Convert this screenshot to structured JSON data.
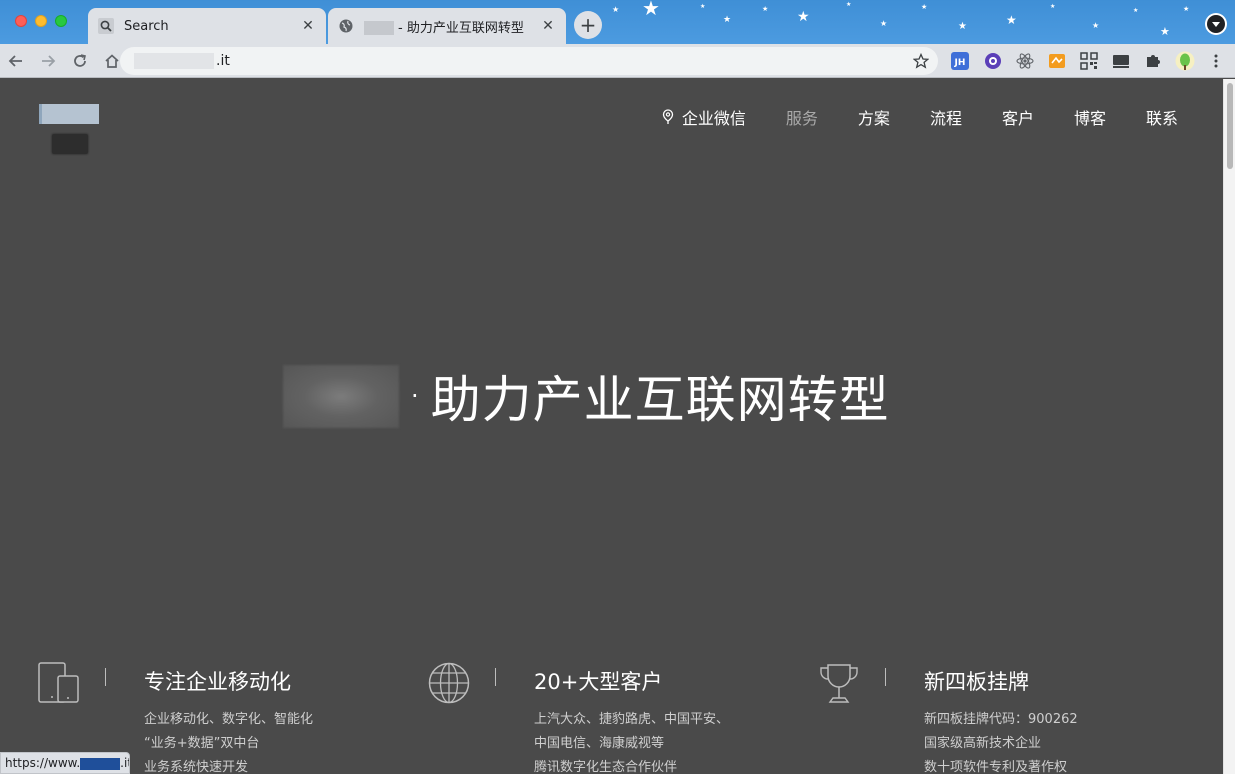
{
  "browser": {
    "tabs": [
      {
        "label": "Search",
        "icon": "search-icon",
        "active": true
      },
      {
        "label": "- 助力产业互联网转型",
        "icon": "globe-icon",
        "active": false
      }
    ],
    "new_tab_label": "+",
    "address": ".it",
    "status_url_prefix": "https://www.",
    "status_url_suffix": ".it",
    "extensions": [
      "jh-extension-icon",
      "w-extension-icon",
      "react-devtools-icon",
      "orange-extension-icon",
      "qr-code-icon",
      "cast-icon",
      "puzzle-extensions-icon",
      "profile-avatar-icon",
      "kebab-menu-icon"
    ]
  },
  "site": {
    "nav": [
      {
        "label": "企业微信",
        "icon": "location-pin-icon",
        "muted": false
      },
      {
        "label": "服务",
        "muted": true
      },
      {
        "label": "方案",
        "muted": false
      },
      {
        "label": "流程",
        "muted": false
      },
      {
        "label": "客户",
        "muted": false
      },
      {
        "label": "博客",
        "muted": false
      },
      {
        "label": "联系",
        "muted": false
      }
    ],
    "hero": {
      "separator": "·",
      "title": "助力产业互联网转型"
    },
    "features": [
      {
        "icon": "mobile-devices-icon",
        "heading": "专注企业移动化",
        "lines": [
          "企业移动化、数字化、智能化",
          "“业务+数据”双中台",
          "业务系统快速开发"
        ]
      },
      {
        "icon": "globe-icon",
        "heading": "20+大型客户",
        "lines": [
          "上汽大众、捷豹路虎、中国平安、",
          "中国电信、海康威视等",
          "腾讯数字化生态合作伙伴"
        ]
      },
      {
        "icon": "trophy-icon",
        "heading": "新四板挂牌",
        "lines": [
          "新四板挂牌代码：900262",
          "国家级高新技术企业",
          "数十项软件专利及著作权"
        ]
      }
    ]
  },
  "colors": {
    "page_bg": "#4a4a4a",
    "tabbar_bg": "#4c9be0",
    "chrome_bg": "#dee1e6",
    "nav_muted": "#a9a9a9"
  }
}
